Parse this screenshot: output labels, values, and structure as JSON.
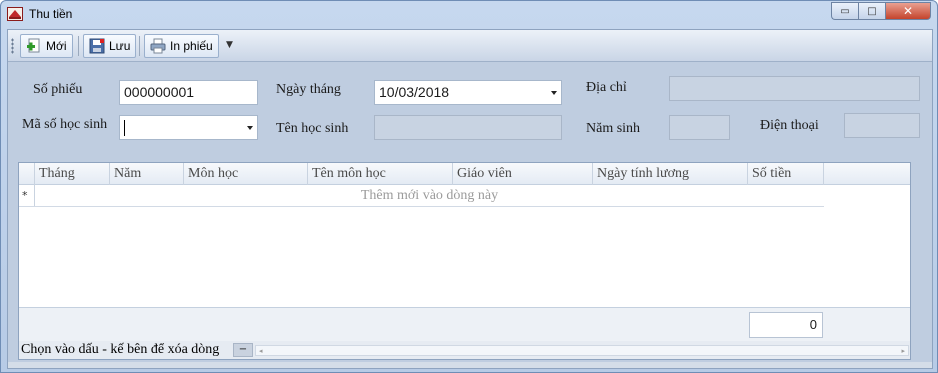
{
  "window": {
    "title": "Thu tiền",
    "minimize_glyph": "▭",
    "maximize_glyph": "□",
    "close_glyph": "✕"
  },
  "toolbar": {
    "new_label": "Mới",
    "save_label": "Lưu",
    "print_label": "In phiếu",
    "overflow_glyph": "▼"
  },
  "form": {
    "receipt_no_label": "Số phiếu",
    "receipt_no_value": "000000001",
    "date_label": "Ngày tháng",
    "date_value": "10/03/2018",
    "address_label": "Địa chỉ",
    "address_value": "",
    "student_id_label": "Mã số học sinh",
    "student_id_value": "",
    "student_name_label": "Tên học sinh",
    "student_name_value": "",
    "birth_year_label": "Năm sinh",
    "birth_year_value": "",
    "phone_label": "Điện thoại",
    "phone_value": ""
  },
  "grid": {
    "columns": [
      "Tháng",
      "Năm",
      "Môn học",
      "Tên môn học",
      "Giáo viên",
      "Ngày tính lương",
      "Số tiền"
    ],
    "new_row_marker": "*",
    "new_row_hint": "Thêm mới vào dòng này",
    "total_value": "0"
  },
  "status": {
    "hint": "Chọn vào dấu - kế bên để xóa dòng",
    "collapse_glyph": "−",
    "scroll_left": "◂",
    "scroll_right": "▸"
  },
  "colors": {
    "window_frame": "#b7cbe6",
    "panel": "#bfcde0",
    "close_button": "#c4442c"
  }
}
